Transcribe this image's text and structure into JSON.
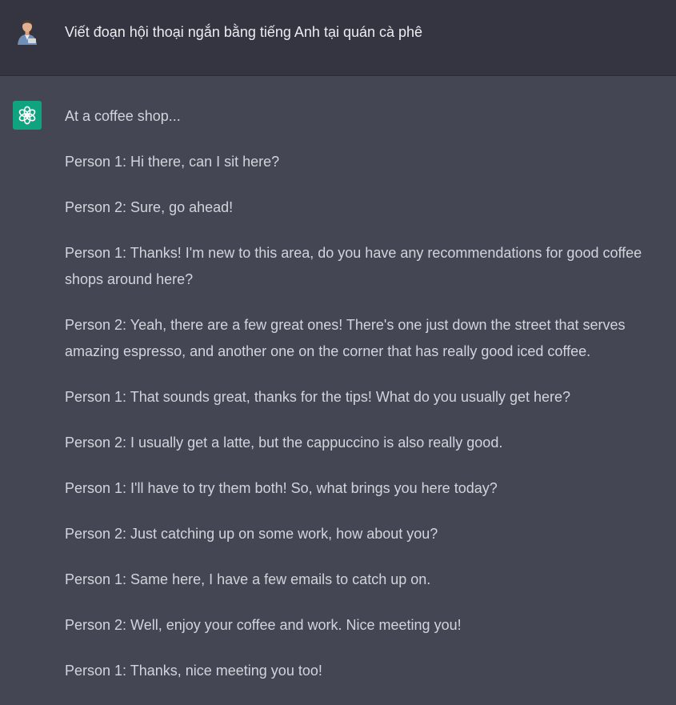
{
  "user_message": {
    "text": "Viết đoạn hội thoại ngắn bằng tiếng Anh tại quán cà phê",
    "avatar_icon": "user-avatar"
  },
  "assistant_message": {
    "icon": "openai-logo-icon",
    "accent_color": "#10a37f",
    "paragraphs": [
      "At a coffee shop...",
      "Person 1: Hi there, can I sit here?",
      "Person 2: Sure, go ahead!",
      "Person 1: Thanks! I'm new to this area, do you have any recommendations for good coffee shops around here?",
      "Person 2: Yeah, there are a few great ones! There's one just down the street that serves amazing espresso, and another one on the corner that has really good iced coffee.",
      "Person 1: That sounds great, thanks for the tips! What do you usually get here?",
      "Person 2: I usually get a latte, but the cappuccino is also really good.",
      "Person 1: I'll have to try them both! So, what brings you here today?",
      "Person 2: Just catching up on some work, how about you?",
      "Person 1: Same here, I have a few emails to catch up on.",
      "Person 2: Well, enjoy your coffee and work. Nice meeting you!",
      "Person 1: Thanks, nice meeting you too!"
    ]
  },
  "colors": {
    "user_bg": "#343541",
    "assistant_bg": "#444654",
    "text": "#d1d5db"
  }
}
